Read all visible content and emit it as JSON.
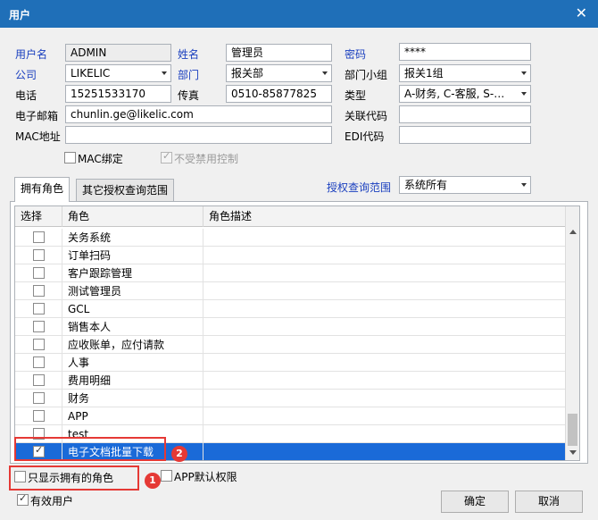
{
  "window": {
    "title": "用户",
    "close_glyph": "✕"
  },
  "form": {
    "username_label": "用户名",
    "username_value": "ADMIN",
    "name_label": "姓名",
    "name_value": "管理员",
    "password_label": "密码",
    "password_value": "****",
    "company_label": "公司",
    "company_value": "LIKELIC",
    "dept_label": "部门",
    "dept_value": "报关部",
    "dept_group_label": "部门小组",
    "dept_group_value": "报关1组",
    "phone_label": "电话",
    "phone_value": "15251533170",
    "fax_label": "传真",
    "fax_value": "0510-85877825",
    "type_label": "类型",
    "type_value": "A-财务, C-客服, S-…",
    "email_label": "电子邮箱",
    "email_value": "chunlin.ge@likelic.com",
    "link_code_label": "关联代码",
    "link_code_value": "",
    "mac_label": "MAC地址",
    "mac_value": "",
    "edi_label": "EDI代码",
    "edi_value": "",
    "mac_bind_label": "MAC绑定",
    "no_ban_label": "不受禁用控制"
  },
  "tabs": [
    {
      "label": "拥有角色"
    },
    {
      "label": "其它授权查询范围"
    }
  ],
  "scope": {
    "label": "授权查询范围",
    "value": "系统所有"
  },
  "grid": {
    "columns": [
      "选择",
      "角色",
      "角色描述"
    ],
    "rows": [
      {
        "name": "关务系统",
        "checked": false
      },
      {
        "name": "订单扫码",
        "checked": false
      },
      {
        "name": "客户跟踪管理",
        "checked": false
      },
      {
        "name": "测试管理员",
        "checked": false
      },
      {
        "name": "GCL",
        "checked": false
      },
      {
        "name": "销售本人",
        "checked": false
      },
      {
        "name": "应收账单，应付请款",
        "checked": false
      },
      {
        "name": "人事",
        "checked": false
      },
      {
        "name": "费用明细",
        "checked": false
      },
      {
        "name": "财务",
        "checked": false
      },
      {
        "name": "APP",
        "checked": false
      },
      {
        "name": "test",
        "checked": false
      },
      {
        "name": "电子文档批量下载",
        "checked": true,
        "selected": true
      }
    ]
  },
  "bottom": {
    "only_owned_label": "只显示拥有的角色",
    "app_default_label": "APP默认权限",
    "valid_user_label": "有效用户",
    "ok_label": "确定",
    "cancel_label": "取消",
    "check_glyph": "✓"
  },
  "annotations": {
    "badge1": "1",
    "badge2": "2",
    "color": "#e53935"
  },
  "colors": {
    "titlebar": "#1f6fb8",
    "selection": "#1a6ad8",
    "label_blue": "#1a3fbf"
  }
}
